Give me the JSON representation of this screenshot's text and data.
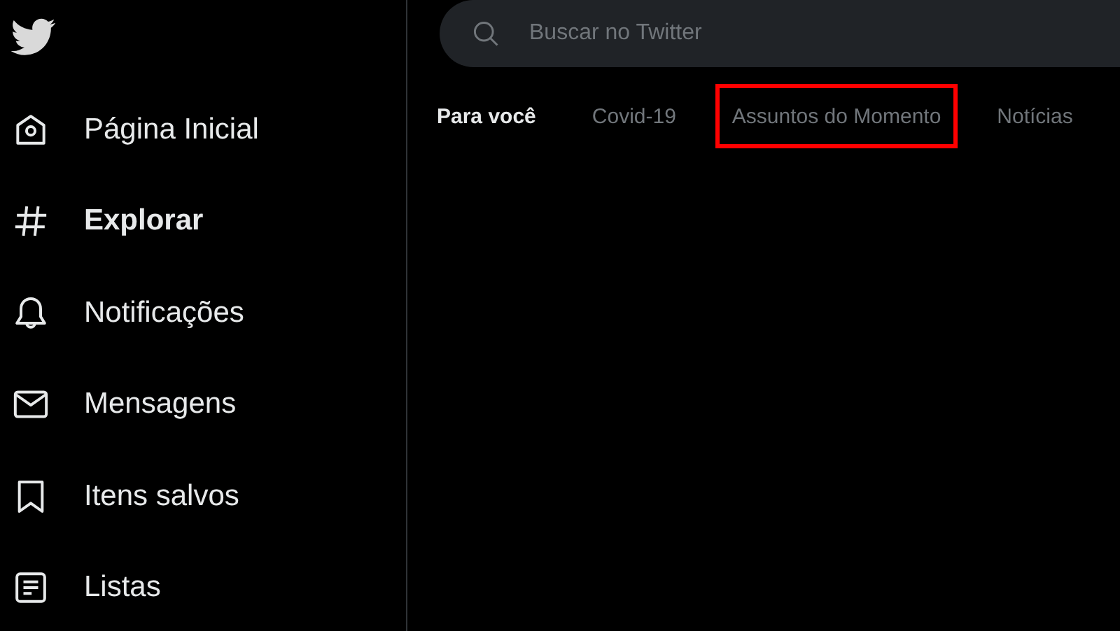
{
  "nav": {
    "items": [
      {
        "label": "Página Inicial",
        "kind": "home",
        "selected": false
      },
      {
        "label": "Explorar",
        "kind": "hash",
        "selected": true
      },
      {
        "label": "Notificações",
        "kind": "bell",
        "selected": false
      },
      {
        "label": "Mensagens",
        "kind": "mail",
        "selected": false
      },
      {
        "label": "Itens salvos",
        "kind": "bookmark",
        "selected": false
      },
      {
        "label": "Listas",
        "kind": "list",
        "selected": false
      }
    ]
  },
  "search": {
    "placeholder": "Buscar no Twitter"
  },
  "tabs": [
    {
      "label": "Para você",
      "selected": true,
      "highlighted": false
    },
    {
      "label": "Covid-19",
      "selected": false,
      "highlighted": false
    },
    {
      "label": "Assuntos do Momento",
      "selected": false,
      "highlighted": true
    },
    {
      "label": "Notícias",
      "selected": false,
      "highlighted": false
    }
  ]
}
